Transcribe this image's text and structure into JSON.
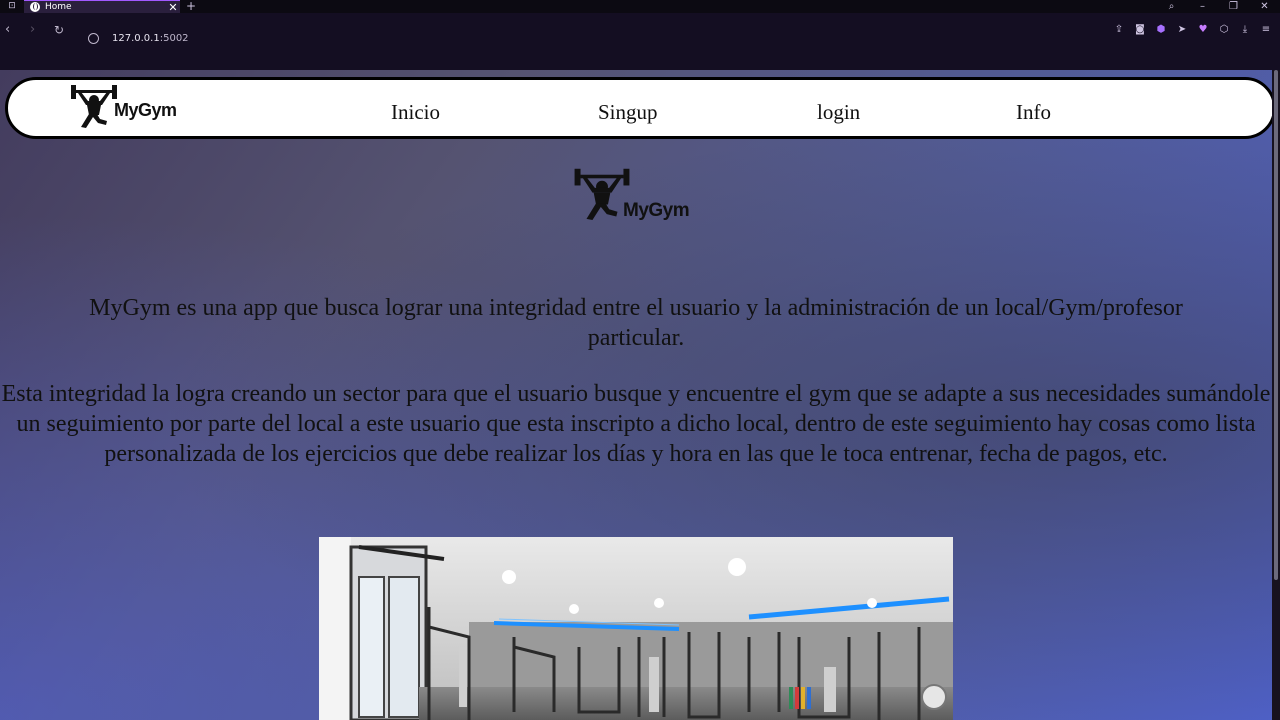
{
  "browser": {
    "tab_title": "Home",
    "new_tab": "+",
    "url_host": "127.0.0.1",
    "url_port": ":5002"
  },
  "navbar": {
    "logo_text": "MyGym",
    "links": [
      "Inicio",
      "Singup",
      "login",
      "Info"
    ]
  },
  "hero": {
    "logo_text": "MyGym"
  },
  "content": {
    "paragraph1": "MyGym es una app que busca lograr una integridad entre el usuario y la administración de un local/Gym/profesor particular.",
    "paragraph2": "Esta integridad la logra creando un sector para que el usuario busque y encuentre el gym que se adapte a sus necesidades sumándole un seguimiento por parte del local a este usuario que esta inscripto a dicho local, dentro de este seguimiento hay cosas como lista personalizada de los ejercicios que debe realizar los días y hora en las que le toca entrenar, fecha de pagos, etc."
  },
  "colors": {
    "accent": "#a259ff",
    "blue_led": "#1e90ff"
  }
}
